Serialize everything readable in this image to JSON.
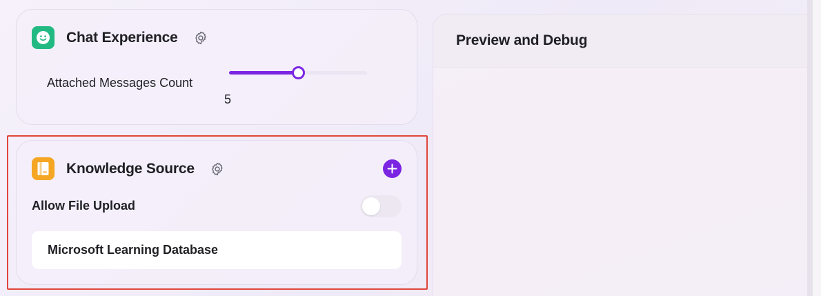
{
  "chat_experience": {
    "title": "Chat Experience",
    "icon": "smiley-icon",
    "icon_color": "#23b983",
    "settings_icon": "gear-icon",
    "attached_messages": {
      "label": "Attached Messages Count",
      "value": "5",
      "slider_fraction": 0.5,
      "accent_color": "#7b25e3"
    }
  },
  "knowledge_source": {
    "title": "Knowledge Source",
    "icon": "book-icon",
    "icon_color": "#f5a623",
    "settings_icon": "gear-icon",
    "add_icon": "plus-icon",
    "allow_file_upload": {
      "label": "Allow File Upload",
      "enabled": false
    },
    "sources": [
      {
        "name": "Microsoft Learning Database"
      }
    ]
  },
  "preview": {
    "title": "Preview and Debug"
  }
}
